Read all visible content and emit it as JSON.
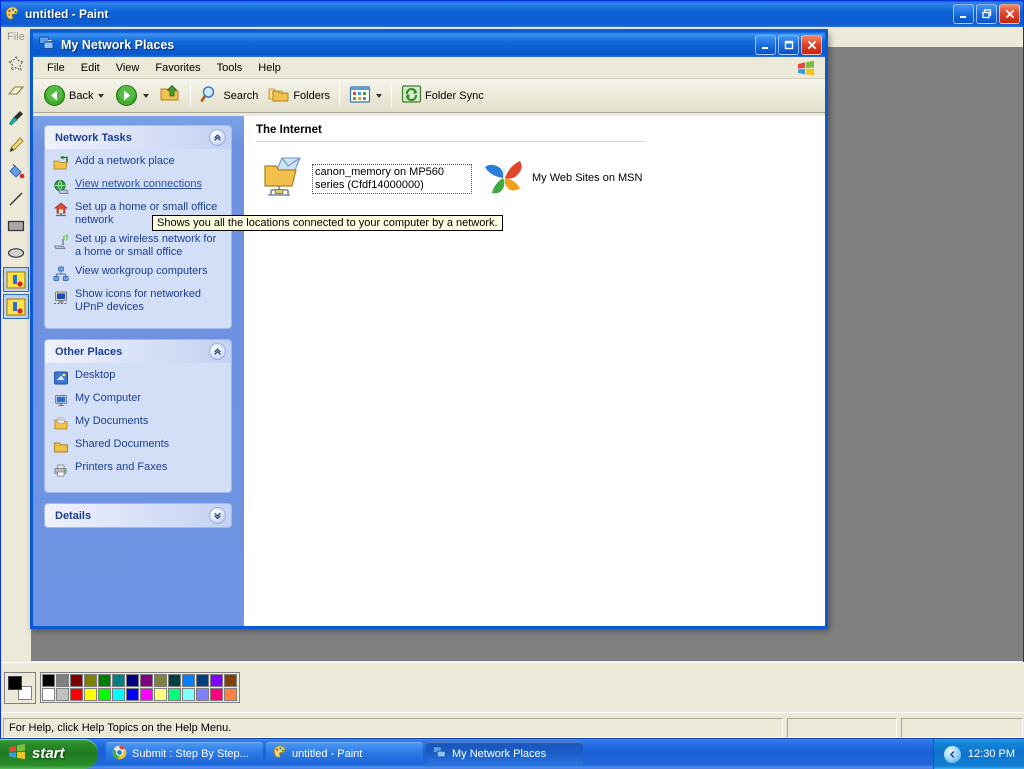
{
  "paint": {
    "title": "untitled - Paint",
    "logo_icon": "paint-palette-icon",
    "menus": [
      "File"
    ],
    "window_buttons": [
      {
        "name": "minimize",
        "glyph": "_"
      },
      {
        "name": "restore",
        "glyph": "❐"
      },
      {
        "name": "close",
        "glyph": "✕"
      }
    ],
    "tools": [
      "free-form-select-icon",
      "eraser-icon",
      "pick-color-icon",
      "pencil-icon",
      "fill-with-color-icon",
      "line-icon",
      "rectangle-icon",
      "ellipse-icon",
      "custom-tool-1-icon",
      "custom-tool-2-icon"
    ],
    "status": {
      "help_text": "For Help, click Help Topics on the Help Menu.",
      "coords": "",
      "size": ""
    },
    "palette": {
      "foreground": "#000000",
      "background": "#ffffff",
      "row1": [
        "#000000",
        "#808080",
        "#800000",
        "#808000",
        "#008000",
        "#008080",
        "#000080",
        "#800080",
        "#808040",
        "#004040",
        "#0080ff",
        "#004080",
        "#8000ff",
        "#804000"
      ],
      "row2": [
        "#ffffff",
        "#c0c0c0",
        "#ff0000",
        "#ffff00",
        "#00ff00",
        "#00ffff",
        "#0000ff",
        "#ff00ff",
        "#ffff80",
        "#00ff80",
        "#80ffff",
        "#8080ff",
        "#ff0080",
        "#ff8040"
      ]
    },
    "canvas_color": "#808080"
  },
  "explorer": {
    "title": "My Network Places",
    "title_icon": "network-places-icon",
    "window_buttons": [
      {
        "name": "minimize",
        "glyph": "_"
      },
      {
        "name": "maximize",
        "glyph": "❐"
      },
      {
        "name": "close",
        "glyph": "✕"
      }
    ],
    "menubar": [
      "File",
      "Edit",
      "View",
      "Favorites",
      "Tools",
      "Help"
    ],
    "menubar_logo": "windows-flag-icon",
    "toolbar": {
      "back": "Back",
      "search": "Search",
      "folders": "Folders",
      "folder_sync": "Folder Sync",
      "icons": {
        "back": "back-arrow-icon",
        "forward": "forward-arrow-icon",
        "up": "up-folder-icon",
        "search": "magnifier-icon",
        "folders": "folders-icon",
        "views": "views-icon",
        "folder_sync": "folder-sync-icon"
      }
    },
    "sidebar": {
      "panels": [
        {
          "title": "Network Tasks",
          "chevron": "chevron-up-icon",
          "items": [
            {
              "label": "Add a network place",
              "icon": "add-network-place-icon",
              "link": false
            },
            {
              "label": "View network connections",
              "icon": "network-connections-icon",
              "link": true
            },
            {
              "label": "Set up a home or small office network",
              "icon": "home-network-icon",
              "link": false
            },
            {
              "label": "Set up a wireless network for a home or small office",
              "icon": "wireless-network-icon",
              "link": false
            },
            {
              "label": "View workgroup computers",
              "icon": "workgroup-icon",
              "link": false
            },
            {
              "label": "Show icons for networked UPnP devices",
              "icon": "upnp-devices-icon",
              "link": false
            }
          ]
        },
        {
          "title": "Other Places",
          "chevron": "chevron-up-icon",
          "items": [
            {
              "label": "Desktop",
              "icon": "desktop-icon",
              "link": false
            },
            {
              "label": "My Computer",
              "icon": "my-computer-icon",
              "link": false
            },
            {
              "label": "My Documents",
              "icon": "my-documents-icon",
              "link": false
            },
            {
              "label": "Shared Documents",
              "icon": "shared-documents-icon",
              "link": false
            },
            {
              "label": "Printers and Faxes",
              "icon": "printers-and-faxes-icon",
              "link": false
            }
          ]
        },
        {
          "title": "Details",
          "chevron": "chevron-down-icon",
          "items": []
        }
      ]
    },
    "content": {
      "group_header": "The Internet",
      "items": [
        {
          "label": "canon_memory on MP560 series (Cfdf14000000)",
          "icon": "network-share-folder-icon",
          "selected": true
        },
        {
          "label": "My Web Sites on MSN",
          "icon": "msn-butterfly-icon",
          "selected": false
        }
      ]
    },
    "tooltip": "Shows you all the locations connected to your computer by a network."
  },
  "taskbar": {
    "start_label": "start",
    "start_icon": "windows-flag-icon",
    "items": [
      {
        "label": "Submit : Step By Step...",
        "icon": "chrome-icon",
        "active": false
      },
      {
        "label": "untitled - Paint",
        "icon": "paint-palette-icon",
        "active": false
      },
      {
        "label": "My Network Places",
        "icon": "network-places-icon",
        "active": true
      }
    ],
    "tray": {
      "show_hidden_icons": "chevron-left-icon",
      "clock": "12:30 PM"
    }
  },
  "desktop": {
    "background_color": "#5a7edc"
  }
}
